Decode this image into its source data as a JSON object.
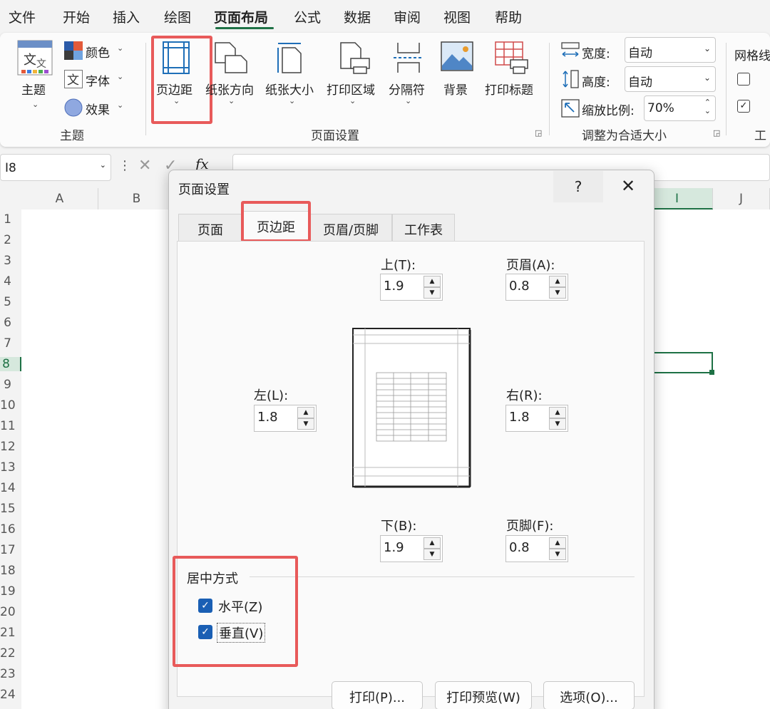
{
  "menu": {
    "items": [
      "文件",
      "开始",
      "插入",
      "绘图",
      "页面布局",
      "公式",
      "数据",
      "审阅",
      "视图",
      "帮助"
    ],
    "active": "页面布局"
  },
  "ribbon": {
    "theme": {
      "label": "主题",
      "colors": "颜色",
      "fonts": "字体",
      "effects": "效果",
      "group": "主题"
    },
    "page_setup": {
      "margins": "页边距",
      "orientation": "纸张方向",
      "size": "纸张大小",
      "print_area": "打印区域",
      "breaks": "分隔符",
      "background": "背景",
      "print_titles": "打印标题",
      "group": "页面设置"
    },
    "scale": {
      "width_label": "宽度:",
      "width_value": "自动",
      "height_label": "高度:",
      "height_value": "自动",
      "scale_label": "缩放比例:",
      "scale_value": "70%",
      "group": "调整为合适大小"
    },
    "sheet_options": {
      "label": "网格线",
      "group": "工"
    }
  },
  "formula_bar": {
    "name_box": "I8",
    "fx": "fx"
  },
  "grid": {
    "columns": [
      "A",
      "B",
      "I",
      "J"
    ],
    "rows": [
      "1",
      "2",
      "3",
      "4",
      "5",
      "6",
      "7",
      "8",
      "9",
      "10",
      "11",
      "12",
      "13",
      "14",
      "15",
      "16",
      "17",
      "18",
      "19",
      "20",
      "21",
      "22",
      "23",
      "24"
    ],
    "selected_cell": "I8"
  },
  "dialog": {
    "title": "页面设置",
    "help": "?",
    "close": "✕",
    "tabs": [
      "页面",
      "页边距",
      "页眉/页脚",
      "工作表"
    ],
    "active_tab": "页边距",
    "top_label": "上(T):",
    "top_value": "1.9",
    "header_label": "页眉(A):",
    "header_value": "0.8",
    "left_label": "左(L):",
    "left_value": "1.8",
    "right_label": "右(R):",
    "right_value": "1.8",
    "bottom_label": "下(B):",
    "bottom_value": "1.9",
    "footer_label": "页脚(F):",
    "footer_value": "0.8",
    "center_group": "居中方式",
    "horizontal": "水平(Z)",
    "horizontal_checked": true,
    "vertical": "垂直(V)",
    "vertical_checked": true,
    "buttons": {
      "print": "打印(P)...",
      "preview": "打印预览(W)",
      "options": "选项(O)..."
    }
  },
  "colors": {
    "accent": "#1e7145",
    "highlight": "#e85a5a",
    "checkbox": "#1a5fb4"
  }
}
